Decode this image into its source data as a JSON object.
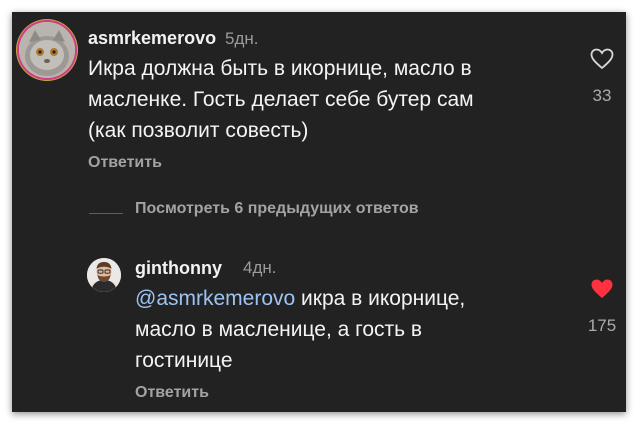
{
  "comments": [
    {
      "username": "asmrkemerovo",
      "time": "5дн.",
      "text": "Икра должна быть в икорнице, масло в\nмасленке. Гость делает себе бутер сам\n(как позволит совесть)",
      "reply_label": "Ответить",
      "likes": "33",
      "liked": false,
      "avatar_icon": "cat-avatar"
    },
    {
      "username": "ginthonny",
      "time": "4дн.",
      "mention": "@asmrkemerovo",
      "text": " икра в икорнице,\nмасло в масленице, а гость в\nгостинице",
      "reply_label": "Ответить",
      "likes": "175",
      "liked": true,
      "avatar_icon": "man-avatar"
    }
  ],
  "view_previous_replies": "Посмотреть 6 предыдущих ответов",
  "colors": {
    "background": "#222223",
    "mention": "#9ec3f3",
    "like_active": "#ff3040",
    "story_ring": "#d23c84"
  }
}
